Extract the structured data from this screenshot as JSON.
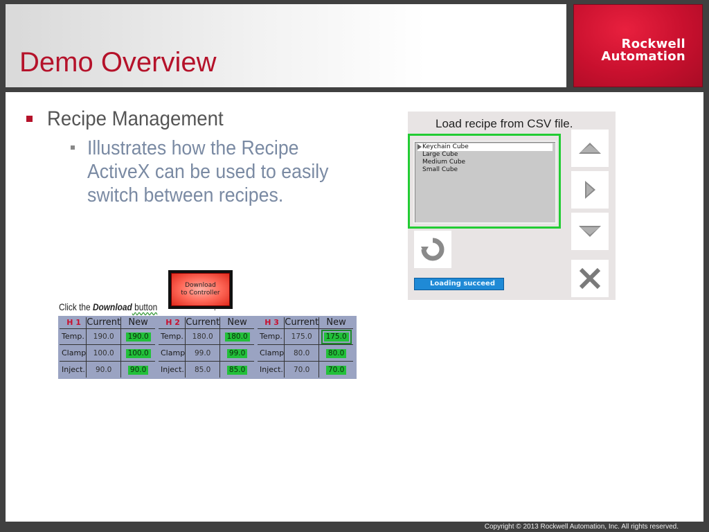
{
  "header": {
    "title": "Demo Overview",
    "logo_line1": "Rockwell",
    "logo_line2": "Automation"
  },
  "bullets": {
    "level1": "Recipe Management",
    "level2": "Illustrates how the Recipe ActiveX can be used to easily switch between recipes."
  },
  "recipe_panel": {
    "title": "Load recipe from CSV file.",
    "items": [
      "Keychain Cube",
      "Large Cube",
      "Medium Cube",
      "Small Cube"
    ],
    "selected_index": 0,
    "status": "Loading succeed",
    "buttons": [
      "arrow-up-icon",
      "arrow-right-icon",
      "arrow-down-icon",
      "close-icon",
      "refresh-icon"
    ]
  },
  "download": {
    "button_line1": "Download",
    "button_line2": "to Controller",
    "click_prefix": "Click the ",
    "click_bold": "Download",
    "click_suffix": " button",
    "trail": "."
  },
  "tables": [
    {
      "header": "H 1",
      "col_current": "Current",
      "col_new": "New",
      "rows": [
        {
          "label": "Temp.",
          "current": "190.0",
          "new": "190.0"
        },
        {
          "label": "Clamp",
          "current": "100.0",
          "new": "100.0"
        },
        {
          "label": "Inject.",
          "current": "90.0",
          "new": "90.0"
        }
      ]
    },
    {
      "header": "H 2",
      "col_current": "Current",
      "col_new": "New",
      "rows": [
        {
          "label": "Temp.",
          "current": "180.0",
          "new": "180.0"
        },
        {
          "label": "Clamp",
          "current": "99.0",
          "new": "99.0"
        },
        {
          "label": "Inject.",
          "current": "85.0",
          "new": "85.0"
        }
      ]
    },
    {
      "header": "H 3",
      "col_current": "Current",
      "col_new": "New",
      "rows": [
        {
          "label": "Temp.",
          "current": "175.0",
          "new": "175.0"
        },
        {
          "label": "Clamp",
          "current": "80.0",
          "new": "80.0"
        },
        {
          "label": "Inject.",
          "current": "70.0",
          "new": "70.0"
        }
      ]
    }
  ],
  "footer": {
    "copyright": "Copyright © 2013 Rockwell Automation, Inc. All rights reserved."
  },
  "colors": {
    "brand_red": "#c8102e",
    "highlight_green": "#22cc33",
    "status_blue": "#1f8ad6"
  }
}
